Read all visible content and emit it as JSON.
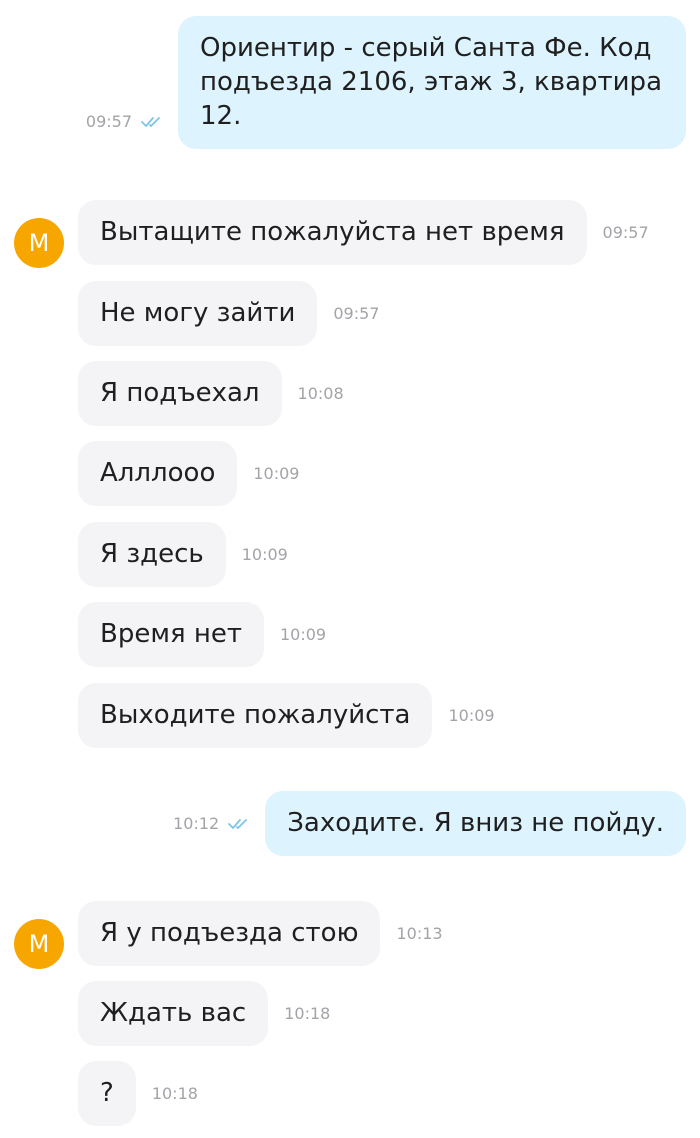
{
  "chat": {
    "messages": [
      {
        "direction": "out",
        "text": "Ориентир - серый Санта Фе. Код подъезда 2106, этаж 3, квартира 12.",
        "time": "09:57",
        "read": true
      },
      {
        "direction": "in",
        "avatar": "М",
        "text": "Вытащите пожалуйста нет время",
        "time": "09:57"
      },
      {
        "direction": "in",
        "text": "Не могу зайти",
        "time": "09:57"
      },
      {
        "direction": "in",
        "text": "Я подъехал",
        "time": "10:08"
      },
      {
        "direction": "in",
        "text": "Алллооо",
        "time": "10:09"
      },
      {
        "direction": "in",
        "text": "Я здесь",
        "time": "10:09"
      },
      {
        "direction": "in",
        "text": "Время нет",
        "time": "10:09"
      },
      {
        "direction": "in",
        "text": "Выходите пожалуйста",
        "time": "10:09"
      },
      {
        "direction": "out",
        "text": "Заходите. Я вниз не пойду.",
        "time": "10:12",
        "read": true
      },
      {
        "direction": "in",
        "avatar": "М",
        "text": "Я у подъезда стою",
        "time": "10:13"
      },
      {
        "direction": "in",
        "text": "Ждать вас",
        "time": "10:18"
      },
      {
        "direction": "in",
        "text": "?",
        "time": "10:18"
      }
    ]
  },
  "colors": {
    "outgoing_bubble": "#ddf3fd",
    "incoming_bubble": "#f4f4f6",
    "avatar_bg": "#f7a600",
    "read_ticks": "#7fc6e6",
    "timestamp": "#a3a3a8"
  },
  "icons": {
    "read_status": "double-check-icon"
  }
}
